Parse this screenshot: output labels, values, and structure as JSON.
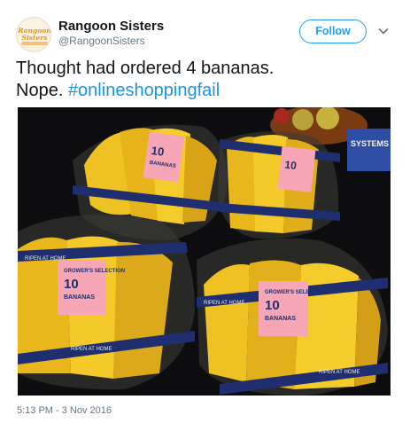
{
  "tweet": {
    "author": {
      "display_name": "Rangoon Sisters",
      "handle": "@RangoonSisters",
      "avatar_logo_text": "Rangoon Sisters",
      "avatar_icon": "brand-logo"
    },
    "follow_label": "Follow",
    "menu_icon": "chevron-down-icon",
    "text_plain": "Thought had ordered 4 bananas. Nope.",
    "text_line1": "Thought had ordered 4 bananas.",
    "text_line2": "Nope.",
    "hashtag": "#onlineshoppingfail",
    "timestamp": "5:13 PM - 3 Nov 2016",
    "photo": {
      "label_brand": "GROWER'S SELECTION",
      "label_count": "10",
      "label_product": "BANANAS",
      "band_text": "RIPEN AT HOME",
      "side_label": "SYSTEMS"
    },
    "colors": {
      "follow_blue": "#1da1f2",
      "hashtag_blue": "#1b95e0",
      "label_pink": "#f6a6b4",
      "band_navy": "#1f2e6e",
      "banana_yellow": "#f2c21c"
    }
  }
}
